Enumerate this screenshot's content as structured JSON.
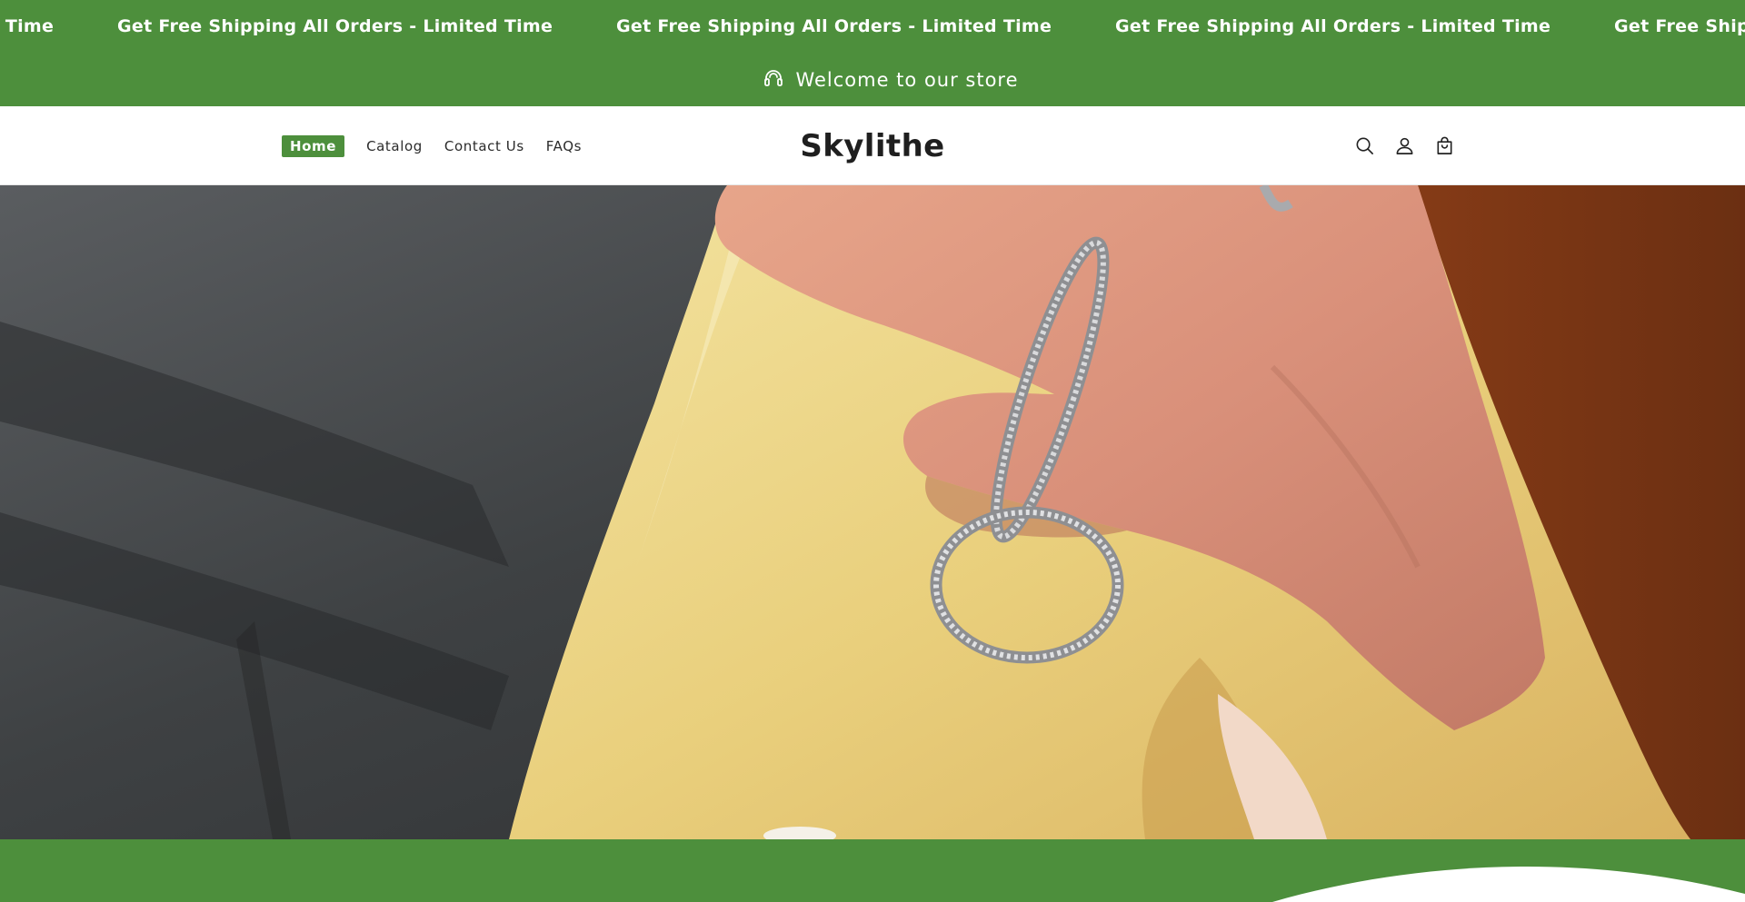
{
  "announcement": {
    "items": [
      "Get Free Shipping All Orders - Limited Time",
      "Get Free Shipping All Orders - Limited Time",
      "Get Free Shipping All Orders - Limited Time",
      "Get Free Shipping All Orders - Limited Time",
      "Get Free Shipping All Orders - Limited Time"
    ],
    "welcome_text": "Welcome to our store"
  },
  "header": {
    "brand": "Skylithe",
    "nav": [
      {
        "label": "Home",
        "active": true
      },
      {
        "label": "Catalog",
        "active": false
      },
      {
        "label": "Contact Us",
        "active": false
      },
      {
        "label": "FAQs",
        "active": false
      }
    ],
    "icons": [
      "search-icon",
      "account-icon",
      "cart-icon"
    ]
  },
  "colors": {
    "accent": "#4d8f3c",
    "background": "#ffffff",
    "text": "#222222"
  }
}
